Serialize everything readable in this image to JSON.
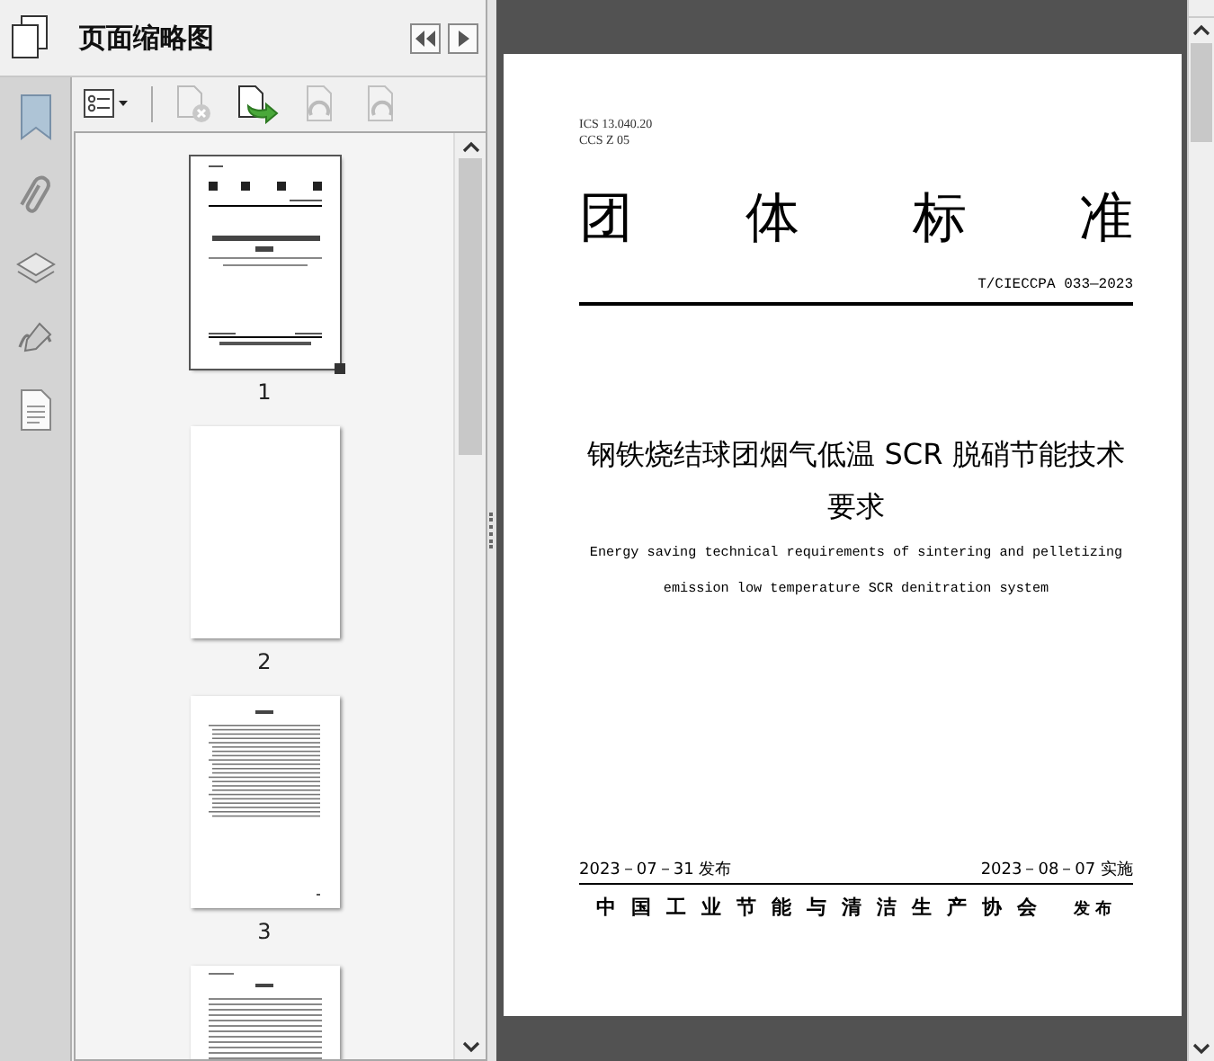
{
  "panel": {
    "title": "页面缩略图"
  },
  "thumbnails": [
    {
      "kind": "cover",
      "label": "1",
      "selected": true
    },
    {
      "kind": "blank",
      "label": "2",
      "selected": false
    },
    {
      "kind": "contents",
      "label": "3",
      "selected": false
    },
    {
      "kind": "text",
      "selected": false
    }
  ],
  "document": {
    "ics": "ICS 13.040.20",
    "ccs": "CCS Z 05",
    "heading": [
      "团",
      "体",
      "标",
      "准"
    ],
    "code": "T/CIECCPA 033—2023",
    "title_lines": [
      "钢铁烧结球团烟气低温 SCR 脱硝节能技术",
      "要求"
    ],
    "english_lines": [
      "Energy saving technical requirements of sintering and pelletizing",
      "emission low temperature SCR denitration system"
    ],
    "publish_date": "2023－07－31 发布",
    "effective_date": "2023－08－07 实施",
    "publisher": "中国工业节能与清洁生产协会",
    "publisher_suffix": "发布"
  }
}
